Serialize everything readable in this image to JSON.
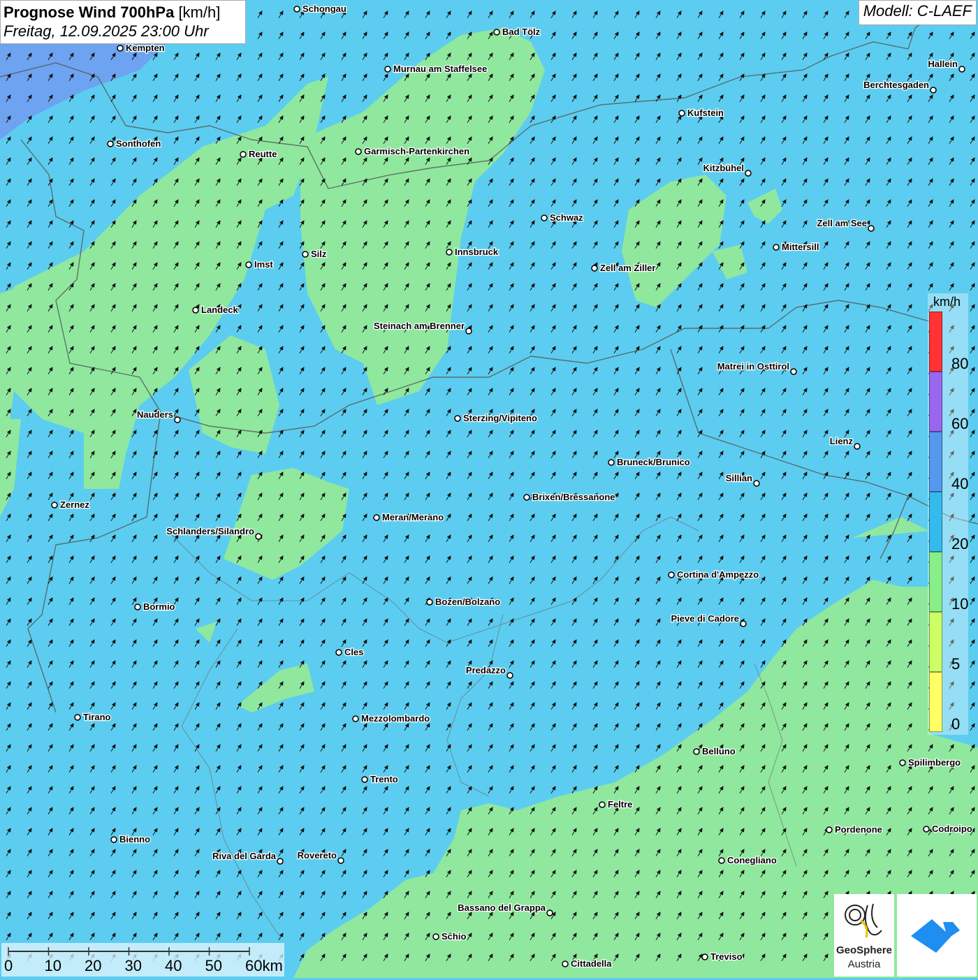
{
  "title": {
    "main_bold": "Prognose Wind 700hPa",
    "main_unit": "[km/h]",
    "subtitle": "Freitag, 12.09.2025 23:00 Uhr"
  },
  "model": "Modell: C-LAEF",
  "legend": {
    "unit": "km/h",
    "levels": [
      {
        "label": "80",
        "color": "#ff3333"
      },
      {
        "label": "60",
        "color": "#9966ee"
      },
      {
        "label": "40",
        "color": "#5599ee"
      },
      {
        "label": "20",
        "color": "#33bbee"
      },
      {
        "label": "10",
        "color": "#88ee88"
      },
      {
        "label": "5",
        "color": "#ccff66"
      },
      {
        "label": "0",
        "color": "#ffff66"
      }
    ],
    "top_color": "#ff3333"
  },
  "scale_bar": {
    "labels": [
      "0",
      "10",
      "20",
      "30",
      "40",
      "50",
      "60km"
    ]
  },
  "logos": {
    "geosphere_line1": "GeoSphere",
    "geosphere_line2": "Austria"
  },
  "map": {
    "colors": {
      "wind_20_40": "#5ccdf0",
      "wind_10_20": "#8fe89e",
      "wind_40_60": "#6f9ef0",
      "border": "#555555",
      "arrow": "#111111"
    },
    "wind_direction": "south-west to north-east",
    "cities": [
      {
        "name": "Schongau"
      },
      {
        "name": "Bad Tölz"
      },
      {
        "name": "Kempten"
      },
      {
        "name": "Murnau am Staffelsee"
      },
      {
        "name": "Hallein"
      },
      {
        "name": "Berchtesgaden"
      },
      {
        "name": "Kufstein"
      },
      {
        "name": "Sonthofen"
      },
      {
        "name": "Reutte"
      },
      {
        "name": "Garmisch-Partenkirchen"
      },
      {
        "name": "Kitzbühel"
      },
      {
        "name": "Schwaz"
      },
      {
        "name": "Zell am See"
      },
      {
        "name": "Mittersill"
      },
      {
        "name": "Innsbruck"
      },
      {
        "name": "Silz"
      },
      {
        "name": "Imst"
      },
      {
        "name": "Zell am Ziller"
      },
      {
        "name": "Landeck"
      },
      {
        "name": "Steinach am Brenner"
      },
      {
        "name": "Matrei in Osttirol"
      },
      {
        "name": "Nauders"
      },
      {
        "name": "Sterzing/Vipiteno"
      },
      {
        "name": "Lienz"
      },
      {
        "name": "Bruneck/Brunico"
      },
      {
        "name": "Sillian"
      },
      {
        "name": "Brixen/Bressanone"
      },
      {
        "name": "Zernez"
      },
      {
        "name": "Meran/Merano"
      },
      {
        "name": "Schlanders/Silandro"
      },
      {
        "name": "Cortina d'Ampezzo"
      },
      {
        "name": "Bozen/Bolzano"
      },
      {
        "name": "Bormio"
      },
      {
        "name": "Pieve di Cadore"
      },
      {
        "name": "Cles"
      },
      {
        "name": "Predazzo"
      },
      {
        "name": "Tirano"
      },
      {
        "name": "Mezzolombardo"
      },
      {
        "name": "Belluno"
      },
      {
        "name": "Spilimbergo"
      },
      {
        "name": "Trento"
      },
      {
        "name": "Feltre"
      },
      {
        "name": "Pordenone"
      },
      {
        "name": "Codroipo"
      },
      {
        "name": "Bienno"
      },
      {
        "name": "Riva del Garda"
      },
      {
        "name": "Rovereto"
      },
      {
        "name": "Conegliano"
      },
      {
        "name": "Bassano del Grappa"
      },
      {
        "name": "Schio"
      },
      {
        "name": "Treviso"
      },
      {
        "name": "Cittadella"
      }
    ]
  }
}
